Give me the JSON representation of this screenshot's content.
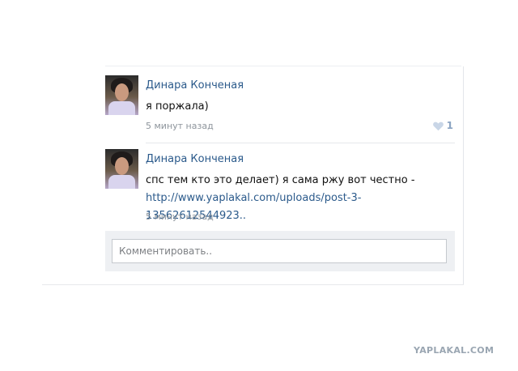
{
  "comments": [
    {
      "author": "Динара Конченая",
      "text": "я поржала)",
      "time": "5 минут назад",
      "likes": "1",
      "avatar_icon": "user-avatar"
    },
    {
      "author": "Динара Конченая",
      "text_before_link": "спс тем кто это делает) я сама ржу вот честно - ",
      "link_text": "http://www.yaplakal.com/uploads/post-3-13562612544923..",
      "time": "5 минут назад",
      "avatar_icon": "user-avatar"
    }
  ],
  "reply": {
    "placeholder": "Комментировать.."
  },
  "watermark": "YAPLAKAL.COM",
  "colors": {
    "link": "#2b5a8b",
    "muted": "#8e959c",
    "like": "#8aa3c2"
  }
}
